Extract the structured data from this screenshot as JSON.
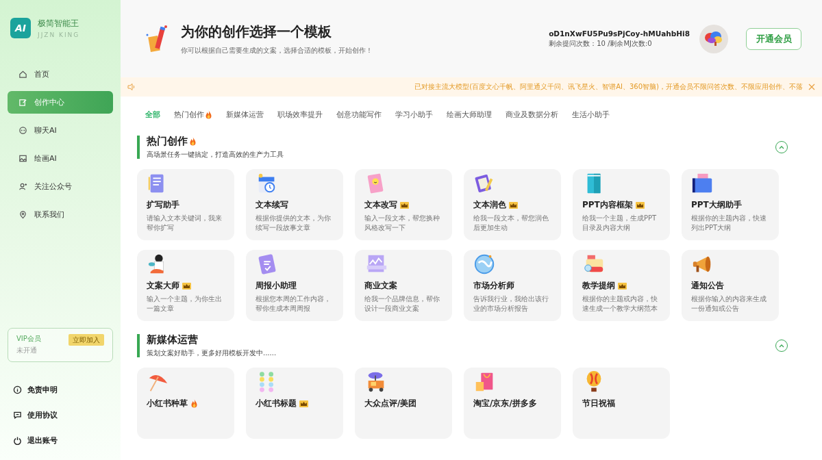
{
  "sidebar": {
    "logo": {
      "mark": "AI",
      "name": "极简智能王",
      "subtitle": "JJZN KING"
    },
    "nav": [
      {
        "label": "首页",
        "selected": false
      },
      {
        "label": "创作中心",
        "selected": true
      },
      {
        "label": "聊天AI",
        "selected": false
      },
      {
        "label": "绘画AI",
        "selected": false
      },
      {
        "label": "关注公众号",
        "selected": false
      },
      {
        "label": "联系我们",
        "selected": false
      }
    ],
    "vip": {
      "title": "VIP会员",
      "status": "未开通",
      "action": "立即加入"
    },
    "footer": [
      "免责申明",
      "使用协议",
      "退出账号"
    ]
  },
  "header": {
    "title": "为你的创作选择一个模板",
    "subtitle": "你可以根据自己需要生成的文案，选择合适的模板，开始创作！",
    "user": "oD1nXwFU5Pu9sPjCoy-hMUahbHi8",
    "quota": "剩余提问次数：10 /剩余MJ次数:0",
    "member_button": "开通会员"
  },
  "notice": {
    "text": "已对接主流大模型(百度文心千帆、阿里通义千问、讯飞星火、智谱AI、360智脑)，开通会员不限问答次数、不限应用创作、不落"
  },
  "tabs": [
    {
      "label": "全部",
      "selected": true,
      "hot": false
    },
    {
      "label": "热门创作",
      "selected": false,
      "hot": true
    },
    {
      "label": "新媒体运营",
      "selected": false,
      "hot": false
    },
    {
      "label": "职场效率提升",
      "selected": false,
      "hot": false
    },
    {
      "label": "创意功能写作",
      "selected": false,
      "hot": false
    },
    {
      "label": "学习小助手",
      "selected": false,
      "hot": false
    },
    {
      "label": "绘画大师助理",
      "selected": false,
      "hot": false
    },
    {
      "label": "商业及数据分析",
      "selected": false,
      "hot": false
    },
    {
      "label": "生活小助手",
      "selected": false,
      "hot": false
    }
  ],
  "sections": [
    {
      "title": "热门创作",
      "hot": true,
      "subtitle": "高场景任务一键搞定，打造高效的生产力工具",
      "expanded": true,
      "cards": [
        {
          "title": "扩写助手",
          "vip": false,
          "hot": false,
          "desc": "请输入文本关键词，我来帮你扩写"
        },
        {
          "title": "文本续写",
          "vip": false,
          "hot": false,
          "desc": "根据你提供的文本，为你续写一段故事文章"
        },
        {
          "title": "文本改写",
          "vip": true,
          "hot": false,
          "desc": "输入一段文本，帮您换种风格改写一下"
        },
        {
          "title": "文本润色",
          "vip": true,
          "hot": false,
          "desc": "给我一段文本，帮您润色后更加生动"
        },
        {
          "title": "PPT内容框架",
          "vip": true,
          "hot": false,
          "desc": "给我一个主题，生成PPT目录及内容大纲"
        },
        {
          "title": "PPT大纲助手",
          "vip": false,
          "hot": false,
          "desc": "根据你的主题内容，快速列出PPT大纲"
        },
        {
          "title": "文案大师",
          "vip": true,
          "hot": false,
          "desc": "输入一个主题，为你生出一篇文章"
        },
        {
          "title": "周报小助理",
          "vip": false,
          "hot": false,
          "desc": "根据您本周的工作内容，帮你生成本周周报"
        },
        {
          "title": "商业文案",
          "vip": false,
          "hot": false,
          "desc": "给我一个品牌信息，帮你设计一段商业文案"
        },
        {
          "title": "市场分析师",
          "vip": false,
          "hot": false,
          "desc": "告诉我行业，我给出该行业的市场分析报告"
        },
        {
          "title": "教学提纲",
          "vip": true,
          "hot": false,
          "desc": "根据你的主题或内容，快速生成一个教学大纲范本"
        },
        {
          "title": "通知公告",
          "vip": false,
          "hot": false,
          "desc": "根据你输入的内容来生成一份通知或公告"
        }
      ]
    },
    {
      "title": "新媒体运营",
      "hot": false,
      "subtitle": "策划文案好助手，更多好用模板开发中......",
      "expanded": true,
      "cards": [
        {
          "title": "小红书种草",
          "vip": false,
          "hot": true
        },
        {
          "title": "小红书标题",
          "vip": true,
          "hot": false
        },
        {
          "title": "大众点评/美团",
          "vip": false,
          "hot": false
        },
        {
          "title": "淘宝/京东/拼多多",
          "vip": false,
          "hot": false
        },
        {
          "title": "节日祝福",
          "vip": false,
          "hot": false
        }
      ]
    }
  ]
}
